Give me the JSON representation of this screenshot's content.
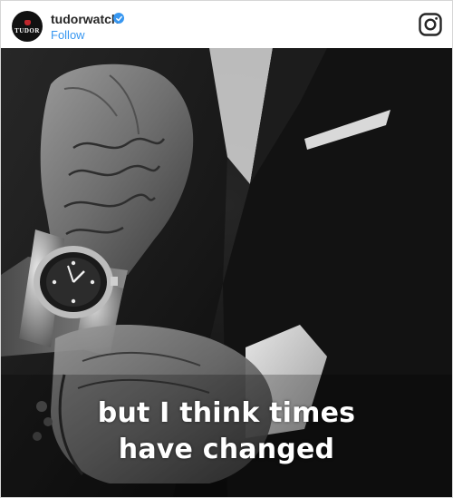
{
  "post": {
    "account": {
      "username": "tudorwatch",
      "verified": true,
      "avatar_logo_text": "TUDOR",
      "follow_label": "Follow"
    },
    "instagram_icon": "instagram-icon",
    "image_caption": {
      "line1": "but I think times",
      "line2": "have changed"
    }
  },
  "colors": {
    "link_blue": "#3897f0",
    "text_dark": "#262626",
    "logo_red": "#c0272d"
  }
}
